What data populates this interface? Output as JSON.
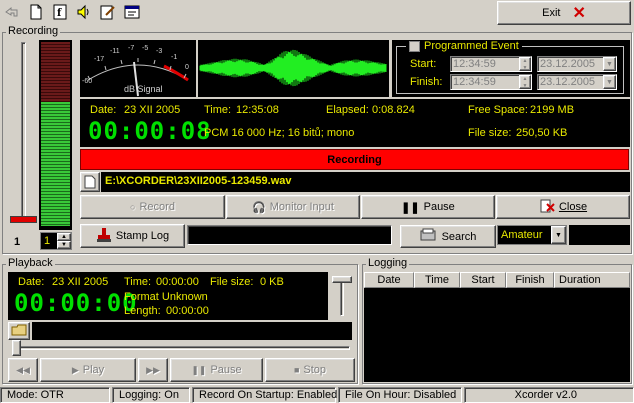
{
  "toolbar": {
    "icons": [
      "undo-icon",
      "new-document-icon",
      "font-icon",
      "speaker-icon",
      "edit-icon",
      "properties-icon"
    ],
    "exit_label": "Exit"
  },
  "recording": {
    "group_title": "Recording",
    "vu_label": "dB Signal",
    "vu_scale": [
      "-60",
      "-17",
      "-11",
      "-7",
      "-5",
      "-3",
      "-1",
      "0"
    ],
    "level_value": 0.55,
    "channel_label": "1",
    "channel_value": "1",
    "programmed": {
      "title": "Programmed  Event",
      "start_label": "Start:",
      "finish_label": "Finish:",
      "start_time": "12:34:59",
      "start_date": "23.12.2005",
      "finish_time": "12:34:59",
      "finish_date": "23.12.2005"
    },
    "info": {
      "date_label": "Date:",
      "date_value": "23 XII 2005",
      "time_label": "Time:",
      "time_value": "12:35:08",
      "elapsed_label": "Elapsed:",
      "elapsed_value": "0:08.824",
      "free_label": "Free Space:",
      "free_value": "2199 MB",
      "counter": "00:00:08",
      "format": "PCM 16 000 Hz; 16 bitů; mono",
      "filesize_label": "File size:",
      "filesize_value": "250,50 KB"
    },
    "status_bar": "Recording",
    "file_path": "E:\\XCORDER\\23XII2005-123459.wav",
    "buttons": {
      "record": "Record",
      "monitor": "Monitor Input",
      "pause": "Pause",
      "close": "Close"
    },
    "stamp_log": "Stamp Log",
    "search": "Search",
    "mode_select": "Amateur"
  },
  "playback": {
    "group_title": "Playback",
    "date_label": "Date:",
    "date_value": "23 XII 2005",
    "time_label": "Time:",
    "time_value": "00:00:00",
    "filesize_label": "File size:",
    "filesize_value": "0 KB",
    "counter": "00:00:00",
    "format": "Format Unknown",
    "length_label": "Length:",
    "length_value": "00:00:00",
    "buttons": {
      "play": "Play",
      "pause": "Pause",
      "stop": "Stop"
    }
  },
  "logging": {
    "group_title": "Logging",
    "columns": [
      "Date",
      "Time",
      "Start",
      "Finish",
      "Duration"
    ]
  },
  "status": {
    "mode": "Mode: OTR",
    "logging": "Logging: On",
    "startup": "Record On Startup: Enabled",
    "filehour": "File On Hour: Disabled",
    "version": "Xcorder v2.0"
  }
}
